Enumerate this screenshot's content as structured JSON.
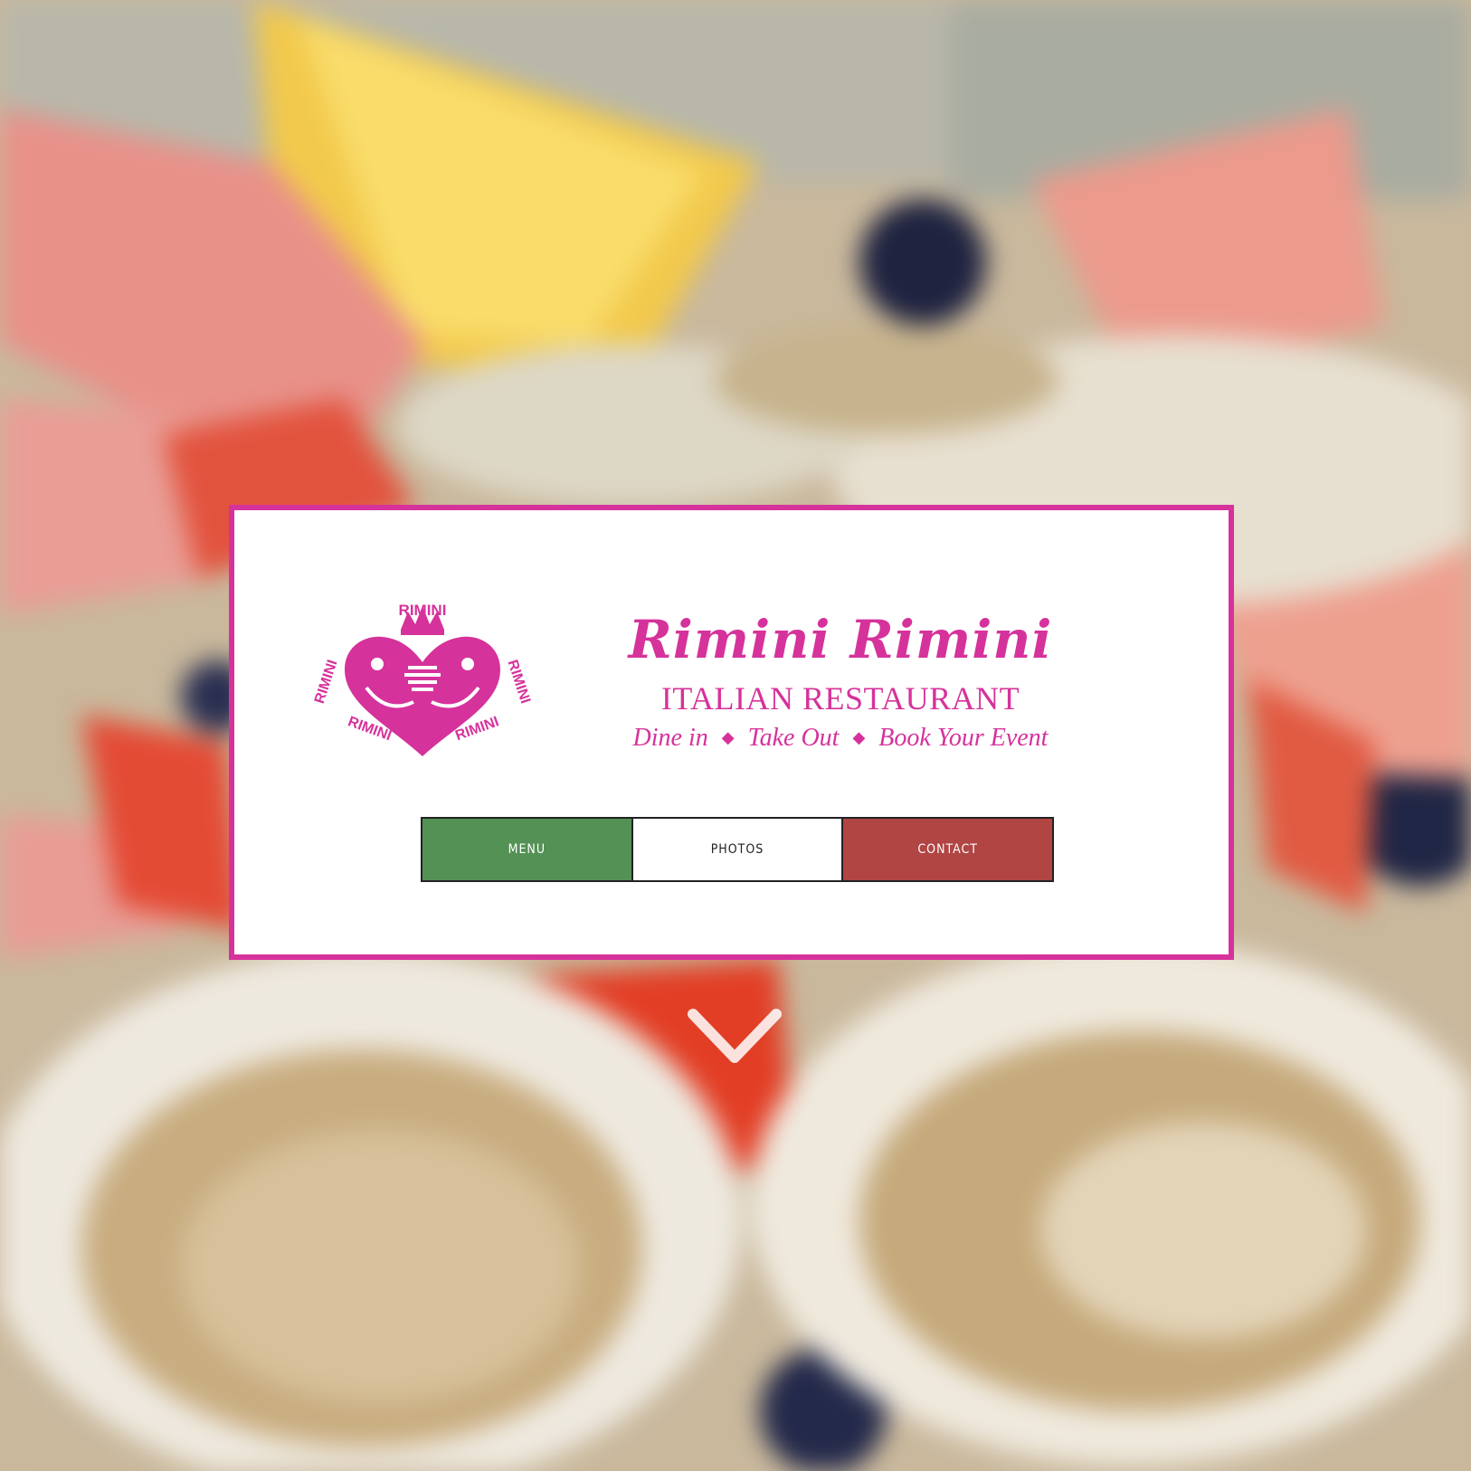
{
  "brand": {
    "title": "Rimini Rimini",
    "subtitle": "ITALIAN RESTAURANT",
    "tagline": [
      "Dine in",
      "Take Out",
      "Book Your Event"
    ],
    "tagline_separator": "◆",
    "color": "#d6329b",
    "logo_text": "RIMINI"
  },
  "nav": {
    "menu_label": "MENU",
    "photos_label": "PHOTOS",
    "contact_label": "CONTACT",
    "menu_color": "#549155",
    "contact_color": "#b04543"
  },
  "icons": {
    "scroll": "chevron-down-icon"
  }
}
